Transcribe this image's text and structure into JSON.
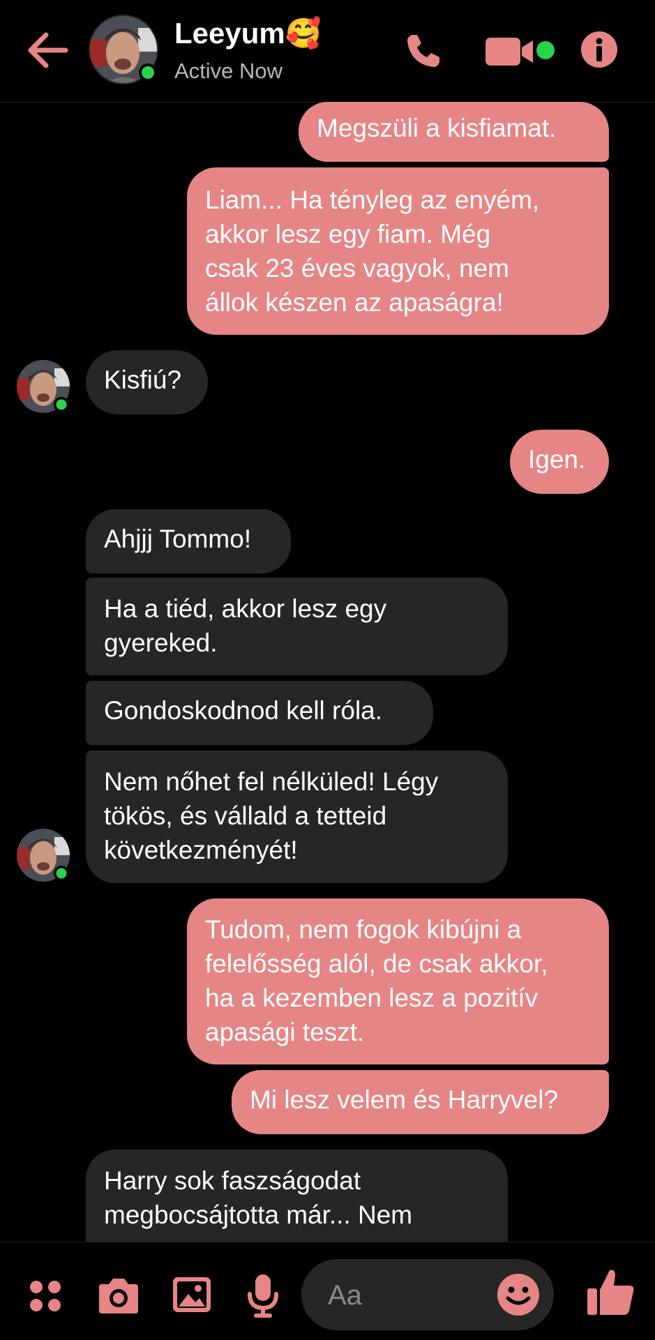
{
  "colors": {
    "accent": "#e68585",
    "bubble_me": "#e68585",
    "bubble_them": "#262626",
    "online": "#2ad34b",
    "background": "#000000"
  },
  "header": {
    "back_icon": "arrow-left-icon",
    "contact_name": "Leeyum🥰",
    "status": "Active Now",
    "call_icon": "phone-icon",
    "video_icon": "video-camera-icon",
    "info_icon": "info-icon"
  },
  "messages": [
    {
      "from": "me",
      "text": "Megszüli a kisfiamat."
    },
    {
      "from": "me",
      "text": "Liam... Ha tényleg az enyém,\nakkor lesz egy fiam. Még\ncsak 23 éves vagyok, nem\nállok készen az apaságra!"
    },
    {
      "from": "them",
      "text": "Kisfiú?"
    },
    {
      "from": "me",
      "text": "Igen."
    },
    {
      "from": "them",
      "text": "Ahjjj Tommo!"
    },
    {
      "from": "them",
      "text": "Ha a tiéd, akkor lesz egy\ngyereked."
    },
    {
      "from": "them",
      "text": "Gondoskodnod kell róla."
    },
    {
      "from": "them",
      "text": "Nem nőhet fel nélküled! Légy\ntökös, és vállald a tetteid\nkövetkezményét!"
    },
    {
      "from": "me",
      "text": "Tudom, nem fogok kibújni a\nfelelősség alól, de csak akkor,\nha a kezemben lesz a pozitív\napasági teszt."
    },
    {
      "from": "me",
      "text": "Mi lesz velem és Harryvel?"
    },
    {
      "from": "them",
      "text": "Harry sok faszságodat\nmegbocsájtotta már... Nem"
    }
  ],
  "composer": {
    "apps_icon": "grid-dots-icon",
    "camera_icon": "camera-icon",
    "gallery_icon": "image-icon",
    "mic_icon": "microphone-icon",
    "placeholder": "Aa",
    "emoji_icon": "smiley-icon",
    "like_icon": "thumbs-up-icon"
  }
}
